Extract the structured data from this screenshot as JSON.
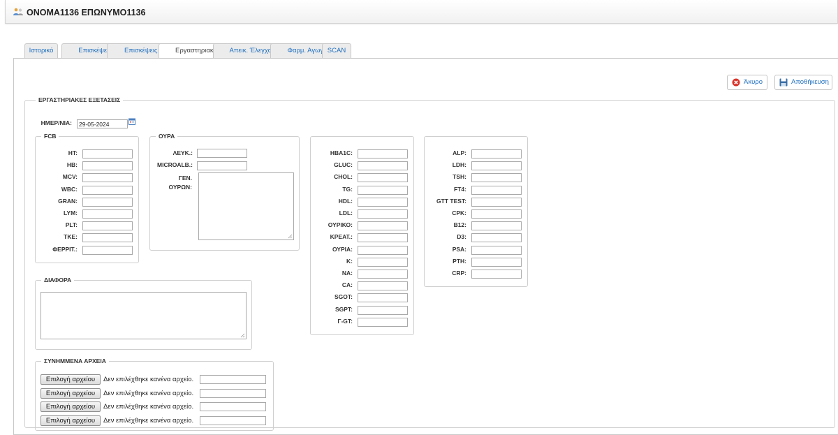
{
  "header": {
    "title": "ONOMA1136 ΕΠΩΝΥΜΟ1136",
    "icon": "users-icon"
  },
  "tabs": [
    {
      "label": "Ιστορικό",
      "active": false
    },
    {
      "label": "Επισκέψεις",
      "active": false
    },
    {
      "label": "Επισκέψεις Σ",
      "active": false
    },
    {
      "label": "Εργαστηριακά",
      "active": true
    },
    {
      "label": "Απεικ. Έλεγχος",
      "active": false
    },
    {
      "label": "Φαρμ. Αγωγή",
      "active": false
    },
    {
      "label": "SCAN",
      "active": false
    }
  ],
  "toolbar": {
    "cancel_label": "Άκυρο",
    "save_label": "Αποθήκευση"
  },
  "exams": {
    "legend": "ΕΡΓΑΣΤΗΡΙΑΚΕΣ ΕΞΕΤΑΣΕΙΣ",
    "date_label": "ΗΜΕΡ/ΝΙΑ:",
    "date_value": "29-05-2024"
  },
  "fcb": {
    "legend": "FCB",
    "fields": [
      "HT:",
      "HB:",
      "MCV:",
      "WBC:",
      "GRAN:",
      "LYM:",
      "PLT:",
      "TKE:",
      "ΦΕΡΡΙΤ.:"
    ]
  },
  "urine": {
    "legend": "ΟΥΡΑ",
    "fields": [
      "ΛΕΥΚ.:",
      "MICROALB.:"
    ],
    "general_label": "ΓΕΝ. ΟΥΡΩΝ:"
  },
  "chem1": {
    "fields": [
      "HBA1C:",
      "GLUC:",
      "CHOL:",
      "TG:",
      "HDL:",
      "LDL:",
      "ΟΥΡΙΚΟ:",
      "ΚΡΕΑΤ.:",
      "ΟΥΡΙΑ:",
      "K:",
      "NA:",
      "CA:",
      "SGOT:",
      "SGPT:",
      "Γ-GT:"
    ]
  },
  "chem2": {
    "fields": [
      "ALP:",
      "LDH:",
      "TSH:",
      "FT4:",
      "GTT TEST:",
      "CPK:",
      "B12:",
      "D3:",
      "PSA:",
      "PTH:",
      "CRP:"
    ]
  },
  "misc": {
    "legend": "ΔΙΑΦΟΡΑ"
  },
  "attachments": {
    "legend": "ΣΥΝΗΜΜΕΝΑ ΑΡΧΕΙΑ",
    "rows": [
      {
        "button": "Επιλογή αρχείου",
        "status": "Δεν επιλέχθηκε κανένα αρχείο."
      },
      {
        "button": "Επιλογή αρχείου",
        "status": "Δεν επιλέχθηκε κανένα αρχείο."
      },
      {
        "button": "Επιλογή αρχείου",
        "status": "Δεν επιλέχθηκε κανένα αρχείο."
      },
      {
        "button": "Επιλογή αρχείου",
        "status": "Δεν επιλέχθηκε κανένα αρχείο."
      }
    ]
  },
  "colors": {
    "link": "#1f6fbf",
    "border": "#c8c8c8",
    "cancel_icon": "#d9342b",
    "save_icon": "#3a6ea5"
  }
}
